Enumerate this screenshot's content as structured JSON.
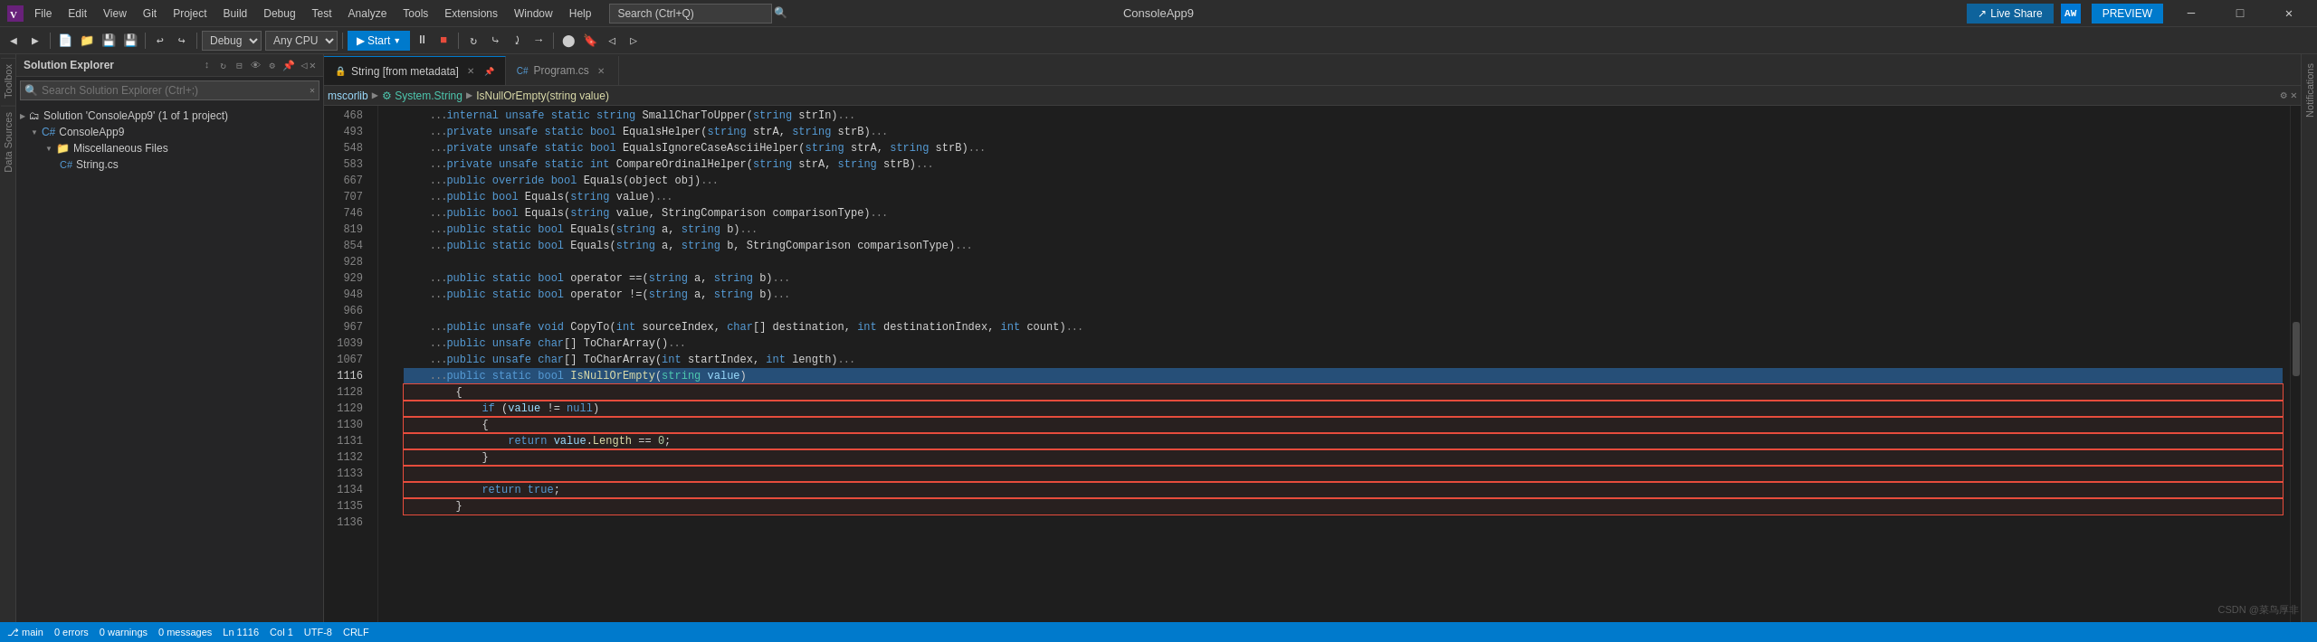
{
  "titlebar": {
    "app_name": "ConsoleApp9",
    "avatar_initials": "AW",
    "live_share_label": "Live Share",
    "preview_label": "PREVIEW"
  },
  "menu": {
    "items": [
      "File",
      "Edit",
      "View",
      "Git",
      "Project",
      "Build",
      "Debug",
      "Test",
      "Analyze",
      "Tools",
      "Extensions",
      "Window",
      "Help"
    ]
  },
  "toolbar": {
    "debug_config": "Debug",
    "platform": "Any CPU",
    "run_label": "Start"
  },
  "solution_explorer": {
    "title": "Solution Explorer",
    "search_placeholder": "Search Solution Explorer (Ctrl+;)",
    "tree": [
      {
        "label": "Solution 'ConsoleApp9' (1 of 1 project)",
        "indent": 0,
        "icon": "solution",
        "expanded": true
      },
      {
        "label": "ConsoleApp9",
        "indent": 1,
        "icon": "project",
        "expanded": true
      },
      {
        "label": "Miscellaneous Files",
        "indent": 2,
        "icon": "folder",
        "expanded": true
      },
      {
        "label": "String.cs",
        "indent": 3,
        "icon": "cs-file"
      }
    ]
  },
  "tabs": [
    {
      "label": "String [from metadata]",
      "active": true,
      "icon": "lock",
      "pinned": false
    },
    {
      "label": "Program.cs",
      "active": false,
      "icon": "cs",
      "pinned": false
    }
  ],
  "breadcrumb": {
    "namespace": "mscorlib",
    "type": "⚙ System.String",
    "method": "IsNullOrEmpty(string value)"
  },
  "code_lines": [
    {
      "num": "468",
      "content": "    ...internal unsafe static string SmallCharToUpper(string strIn)..."
    },
    {
      "num": "493",
      "content": "    ...private unsafe static bool EqualsHelper(string strA, string strB)..."
    },
    {
      "num": "548",
      "content": "    ...private unsafe static bool EqualsIgnoreCaseAsciiHelper(string strA, string strB)..."
    },
    {
      "num": "583",
      "content": "    ...private unsafe static int CompareOrdinalHelper(string strA, string strB)..."
    },
    {
      "num": "667",
      "content": "    ...public override bool Equals(object obj)..."
    },
    {
      "num": "707",
      "content": "    ...public bool Equals(string value)..."
    },
    {
      "num": "746",
      "content": "    ...public bool Equals(string value, StringComparison comparisonType)..."
    },
    {
      "num": "819",
      "content": "    ...public static bool Equals(string a, string b)..."
    },
    {
      "num": "854",
      "content": "    ...public static bool Equals(string a, string b, StringComparison comparisonType)..."
    },
    {
      "num": "928",
      "content": ""
    },
    {
      "num": "929",
      "content": "    ...public static bool operator ==(string a, string b)..."
    },
    {
      "num": "948",
      "content": "    ...public static bool operator !=(string a, string b)..."
    },
    {
      "num": "966",
      "content": ""
    },
    {
      "num": "967",
      "content": "    ...public unsafe void CopyTo(int sourceIndex, char[] destination, int destinationIndex, int count)..."
    },
    {
      "num": "1039",
      "content": "    ...public unsafe char[] ToCharArray()..."
    },
    {
      "num": "1067",
      "content": "    ...public unsafe char[] ToCharArray(int startIndex, int length)..."
    },
    {
      "num": "1116",
      "content": "    ...public static bool IsNullOrEmpty(string value)"
    },
    {
      "num": "1128",
      "content": "        {"
    },
    {
      "num": "1129",
      "content": "            if (value != null)"
    },
    {
      "num": "1130",
      "content": "            {"
    },
    {
      "num": "1131",
      "content": "                return value.Length == 0;"
    },
    {
      "num": "1132",
      "content": "            }"
    },
    {
      "num": "1133",
      "content": ""
    },
    {
      "num": "1134",
      "content": "            return true;"
    },
    {
      "num": "1135",
      "content": "        }"
    },
    {
      "num": "1136",
      "content": ""
    }
  ],
  "vtabs_left": [
    "Toolbox",
    "Data Sources"
  ],
  "vtabs_right": [
    "Notifications"
  ],
  "status_bar": {
    "items": [
      "⎇ main",
      "0 errors",
      "0 warnings",
      "0 messages",
      "Ln 1116",
      "Col 1",
      "UTF-8",
      "CRLF"
    ],
    "watermark": "CSDN @菜鸟厚非"
  }
}
